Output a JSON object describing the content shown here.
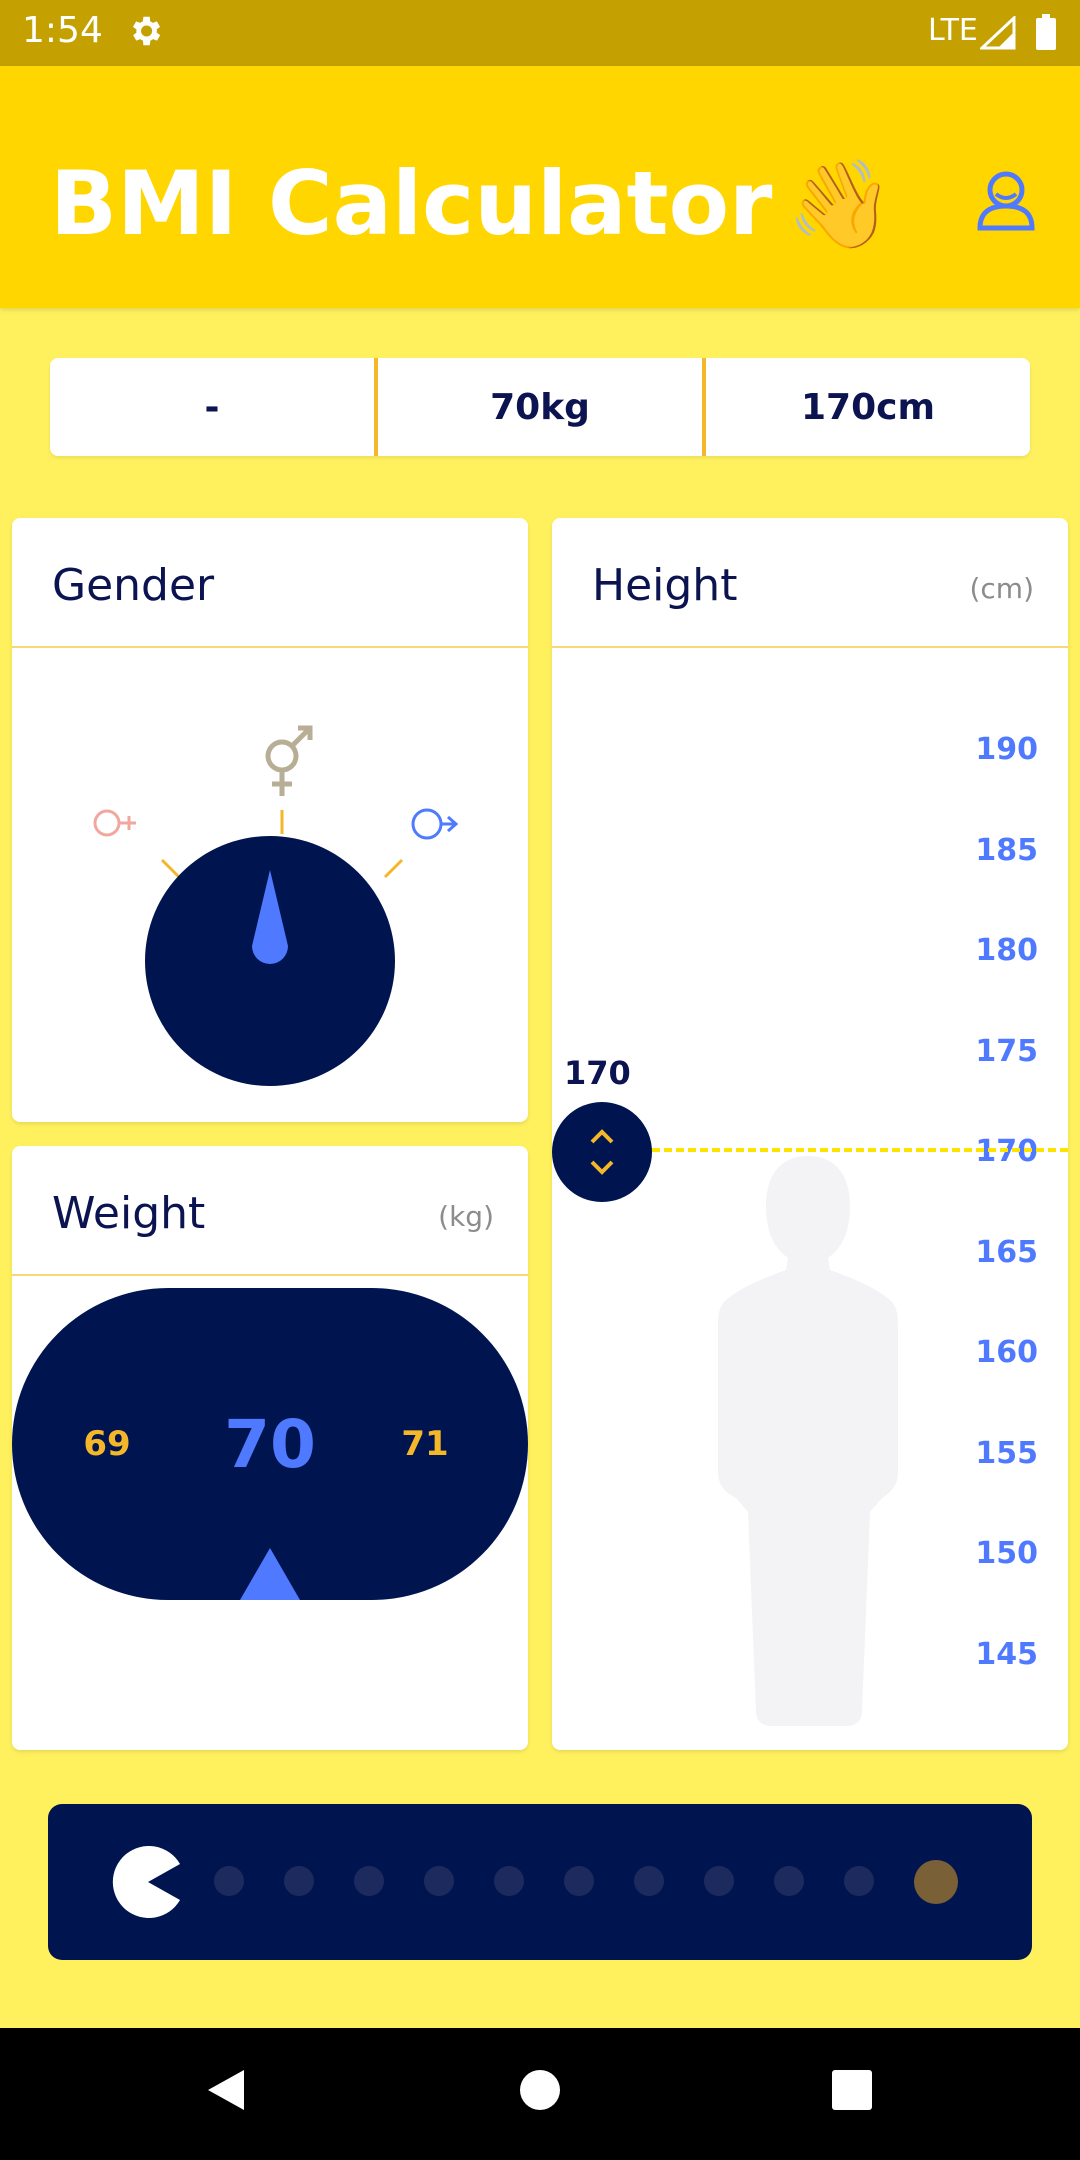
{
  "status_bar": {
    "time": "1:54",
    "network": "LTE"
  },
  "app_bar": {
    "title": "BMI Calculator",
    "emoji": "👋",
    "profile_icon": "person-outline-icon"
  },
  "summary": {
    "gender": "-",
    "weight": "70kg",
    "height": "170cm"
  },
  "gender_card": {
    "title": "Gender",
    "options": [
      "female",
      "other",
      "male"
    ],
    "selected": "other"
  },
  "weight_card": {
    "title": "Weight",
    "unit": "(kg)",
    "prev": "69",
    "current": "70",
    "next": "71"
  },
  "height_card": {
    "title": "Height",
    "unit": "(cm)",
    "ticks": [
      "190",
      "185",
      "180",
      "175",
      "170",
      "165",
      "160",
      "155",
      "150",
      "145"
    ],
    "selected_label": "170"
  },
  "progress": {
    "total_dots": 10,
    "completed": 0
  },
  "colors": {
    "background": "#FFF15E",
    "app_bar": "#FFD600",
    "navy": "#00154F",
    "accent_blue": "#4F79FF",
    "accent_orange": "#F4B72A"
  }
}
